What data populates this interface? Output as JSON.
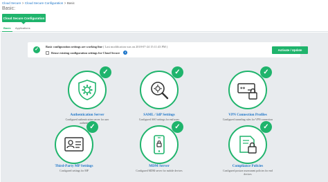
{
  "breadcrumb": {
    "items": [
      "Cloud Secure",
      "Cloud Secure Configuration",
      "Basic"
    ],
    "separator": ">"
  },
  "page_title": "Basic:",
  "top_tab": "Cloud Secure Configuration",
  "sub_tabs": [
    "Basic",
    "Applications"
  ],
  "banner": {
    "status": "Basic configuration settings are working fine",
    "last_modified": "( Last modification was on 2018-07-24 15:11:43 PM )",
    "checkbox_label": "Reuse existing configuration settings for Cloud Secure",
    "button": "Activate / Update"
  },
  "cards": [
    {
      "title": "Authentication Server",
      "desc": "Configured authentication server for user authentication",
      "icon": "shield-gear-icon"
    },
    {
      "title": "SAML / IdP Settings",
      "desc": "Configured SSO settings for end users",
      "icon": "gear-magnifier-icon"
    },
    {
      "title": "VPN Connection Profiles",
      "desc": "Configured tunneling rules for VPN connection",
      "icon": "password-lock-icon"
    },
    {
      "title": "Third-Party MP Settings",
      "desc": "Configured settings for MP",
      "icon": "id-card-icon"
    },
    {
      "title": "MDM Server",
      "desc": "Configured MDM server for mobile devices",
      "icon": "mobile-device-icon"
    },
    {
      "title": "Compliance Policies",
      "desc": "Configured posture assessment policies for end devices",
      "icon": "compliance-lock-icon"
    }
  ],
  "colors": {
    "accent": "#1fb46c",
    "link": "#1a73c8",
    "background": "#e8ebee"
  }
}
